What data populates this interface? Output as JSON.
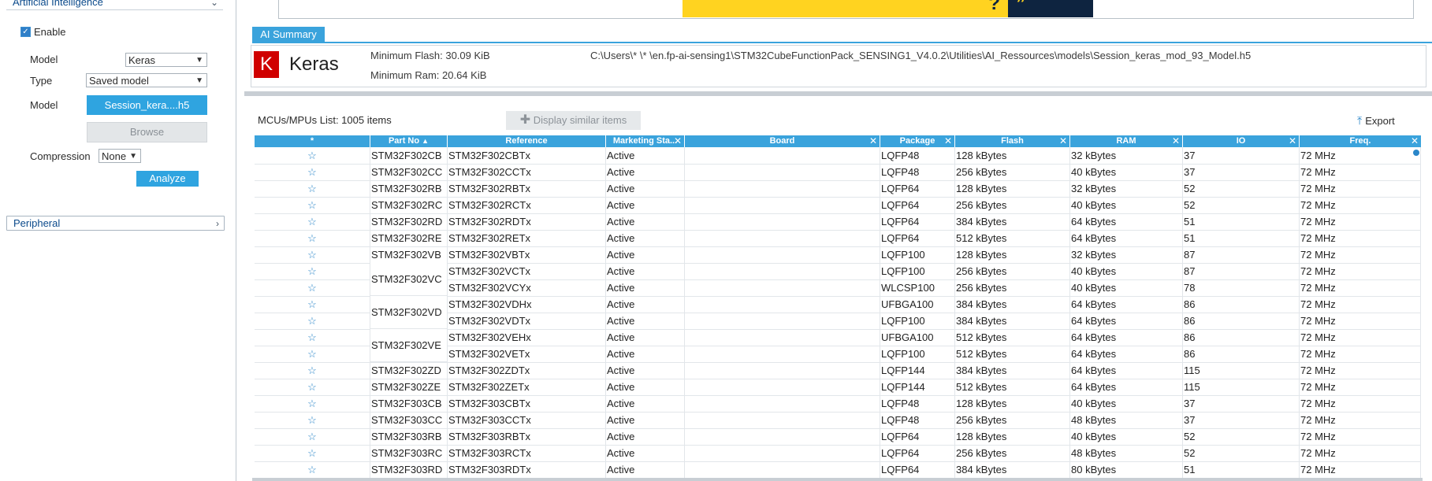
{
  "left_panel": {
    "ai_section": {
      "title": "Artificial Intelligence"
    },
    "enable": {
      "label": "Enable",
      "checked": true
    },
    "model_label": "Model",
    "model_value": "Keras",
    "type_label": "Type",
    "type_value": "Saved model",
    "model_file_label": "Model",
    "model_file_button": "Session_kera....h5",
    "browse_button": "Browse",
    "compression_label": "Compression",
    "compression_value": "None",
    "analyze_button": "Analyze",
    "peripheral_section": {
      "title": "Peripheral"
    }
  },
  "ai_summary": {
    "tab_label": "AI Summary",
    "logo_letter": "K",
    "framework": "Keras",
    "min_flash": "Minimum Flash: 30.09 KiB",
    "min_ram": "Minimum Ram: 20.64 KiB",
    "model_path": "C:\\Users\\*        \\*    \\en.fp-ai-sensing1\\STM32CubeFunctionPack_SENSING1_V4.0.2\\Utilities\\AI_Ressources\\models\\Session_keras_mod_93_Model.h5"
  },
  "list": {
    "count": "MCUs/MPUs List: 1005 items",
    "display_similar": "Display similar items",
    "export": "Export"
  },
  "table": {
    "columns": [
      "*",
      "Part No",
      "Reference",
      "Marketing Sta...",
      "Board",
      "Package",
      "Flash",
      "RAM",
      "IO",
      "Freq."
    ],
    "rows": [
      {
        "part": "STM32F302CB",
        "ref": "STM32F302CBTx",
        "status": "Active",
        "board": "",
        "pkg": "LQFP48",
        "flash": "128 kBytes",
        "ram": "32 kBytes",
        "io": "37",
        "freq": "72 MHz"
      },
      {
        "part": "STM32F302CC",
        "ref": "STM32F302CCTx",
        "status": "Active",
        "board": "",
        "pkg": "LQFP48",
        "flash": "256 kBytes",
        "ram": "40 kBytes",
        "io": "37",
        "freq": "72 MHz"
      },
      {
        "part": "STM32F302RB",
        "ref": "STM32F302RBTx",
        "status": "Active",
        "board": "",
        "pkg": "LQFP64",
        "flash": "128 kBytes",
        "ram": "32 kBytes",
        "io": "52",
        "freq": "72 MHz"
      },
      {
        "part": "STM32F302RC",
        "ref": "STM32F302RCTx",
        "status": "Active",
        "board": "",
        "pkg": "LQFP64",
        "flash": "256 kBytes",
        "ram": "40 kBytes",
        "io": "52",
        "freq": "72 MHz"
      },
      {
        "part": "STM32F302RD",
        "ref": "STM32F302RDTx",
        "status": "Active",
        "board": "",
        "pkg": "LQFP64",
        "flash": "384 kBytes",
        "ram": "64 kBytes",
        "io": "51",
        "freq": "72 MHz"
      },
      {
        "part": "STM32F302RE",
        "ref": "STM32F302RETx",
        "status": "Active",
        "board": "",
        "pkg": "LQFP64",
        "flash": "512 kBytes",
        "ram": "64 kBytes",
        "io": "51",
        "freq": "72 MHz"
      },
      {
        "part": "STM32F302VB",
        "ref": "STM32F302VBTx",
        "status": "Active",
        "board": "",
        "pkg": "LQFP100",
        "flash": "128 kBytes",
        "ram": "32 kBytes",
        "io": "87",
        "freq": "72 MHz"
      },
      {
        "part": "",
        "ref": "STM32F302VCTx",
        "status": "Active",
        "board": "",
        "pkg": "LQFP100",
        "flash": "256 kBytes",
        "ram": "40 kBytes",
        "io": "87",
        "freq": "72 MHz"
      },
      {
        "part": "",
        "ref": "STM32F302VCYx",
        "status": "Active",
        "board": "",
        "pkg": "WLCSP100",
        "flash": "256 kBytes",
        "ram": "40 kBytes",
        "io": "78",
        "freq": "72 MHz"
      },
      {
        "part": "",
        "ref": "STM32F302VDHx",
        "status": "Active",
        "board": "",
        "pkg": "UFBGA100",
        "flash": "384 kBytes",
        "ram": "64 kBytes",
        "io": "86",
        "freq": "72 MHz"
      },
      {
        "part": "",
        "ref": "STM32F302VDTx",
        "status": "Active",
        "board": "",
        "pkg": "LQFP100",
        "flash": "384 kBytes",
        "ram": "64 kBytes",
        "io": "86",
        "freq": "72 MHz"
      },
      {
        "part": "",
        "ref": "STM32F302VEHx",
        "status": "Active",
        "board": "",
        "pkg": "UFBGA100",
        "flash": "512 kBytes",
        "ram": "64 kBytes",
        "io": "86",
        "freq": "72 MHz"
      },
      {
        "part": "",
        "ref": "STM32F302VETx",
        "status": "Active",
        "board": "",
        "pkg": "LQFP100",
        "flash": "512 kBytes",
        "ram": "64 kBytes",
        "io": "86",
        "freq": "72 MHz"
      },
      {
        "part": "STM32F302ZD",
        "ref": "STM32F302ZDTx",
        "status": "Active",
        "board": "",
        "pkg": "LQFP144",
        "flash": "384 kBytes",
        "ram": "64 kBytes",
        "io": "115",
        "freq": "72 MHz"
      },
      {
        "part": "STM32F302ZE",
        "ref": "STM32F302ZETx",
        "status": "Active",
        "board": "",
        "pkg": "LQFP144",
        "flash": "512 kBytes",
        "ram": "64 kBytes",
        "io": "115",
        "freq": "72 MHz"
      },
      {
        "part": "STM32F303CB",
        "ref": "STM32F303CBTx",
        "status": "Active",
        "board": "",
        "pkg": "LQFP48",
        "flash": "128 kBytes",
        "ram": "40 kBytes",
        "io": "37",
        "freq": "72 MHz"
      },
      {
        "part": "STM32F303CC",
        "ref": "STM32F303CCTx",
        "status": "Active",
        "board": "",
        "pkg": "LQFP48",
        "flash": "256 kBytes",
        "ram": "48 kBytes",
        "io": "37",
        "freq": "72 MHz"
      },
      {
        "part": "STM32F303RB",
        "ref": "STM32F303RBTx",
        "status": "Active",
        "board": "",
        "pkg": "LQFP64",
        "flash": "128 kBytes",
        "ram": "40 kBytes",
        "io": "52",
        "freq": "72 MHz"
      },
      {
        "part": "STM32F303RC",
        "ref": "STM32F303RCTx",
        "status": "Active",
        "board": "",
        "pkg": "LQFP64",
        "flash": "256 kBytes",
        "ram": "48 kBytes",
        "io": "52",
        "freq": "72 MHz"
      },
      {
        "part": "STM32F303RD",
        "ref": "STM32F303RDTx",
        "status": "Active",
        "board": "",
        "pkg": "LQFP64",
        "flash": "384 kBytes",
        "ram": "80 kBytes",
        "io": "51",
        "freq": "72 MHz"
      }
    ],
    "merged_parts": [
      {
        "label": "STM32F302VC",
        "row": 7
      },
      {
        "label": "STM32F302VD",
        "row": 9
      },
      {
        "label": "STM32F302VE",
        "row": 11
      }
    ]
  },
  "colors": {
    "accent": "#3aa3dc",
    "star": "#2a86c9",
    "keras_red": "#d00000"
  },
  "icons": {
    "favorite": "star-outline-icon",
    "export": "export-icon",
    "chevron": "chevron-down-icon"
  }
}
